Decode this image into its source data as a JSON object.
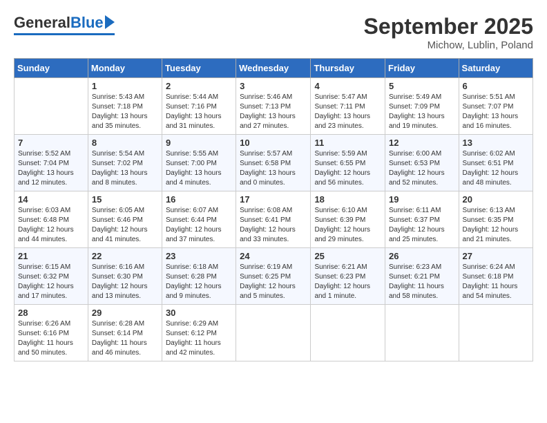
{
  "header": {
    "logo_general": "General",
    "logo_blue": "Blue",
    "month_title": "September 2025",
    "location": "Michow, Lublin, Poland"
  },
  "weekdays": [
    "Sunday",
    "Monday",
    "Tuesday",
    "Wednesday",
    "Thursday",
    "Friday",
    "Saturday"
  ],
  "weeks": [
    [
      {
        "day": "",
        "sunrise": "",
        "sunset": "",
        "daylight": ""
      },
      {
        "day": "1",
        "sunrise": "Sunrise: 5:43 AM",
        "sunset": "Sunset: 7:18 PM",
        "daylight": "Daylight: 13 hours and 35 minutes."
      },
      {
        "day": "2",
        "sunrise": "Sunrise: 5:44 AM",
        "sunset": "Sunset: 7:16 PM",
        "daylight": "Daylight: 13 hours and 31 minutes."
      },
      {
        "day": "3",
        "sunrise": "Sunrise: 5:46 AM",
        "sunset": "Sunset: 7:13 PM",
        "daylight": "Daylight: 13 hours and 27 minutes."
      },
      {
        "day": "4",
        "sunrise": "Sunrise: 5:47 AM",
        "sunset": "Sunset: 7:11 PM",
        "daylight": "Daylight: 13 hours and 23 minutes."
      },
      {
        "day": "5",
        "sunrise": "Sunrise: 5:49 AM",
        "sunset": "Sunset: 7:09 PM",
        "daylight": "Daylight: 13 hours and 19 minutes."
      },
      {
        "day": "6",
        "sunrise": "Sunrise: 5:51 AM",
        "sunset": "Sunset: 7:07 PM",
        "daylight": "Daylight: 13 hours and 16 minutes."
      }
    ],
    [
      {
        "day": "7",
        "sunrise": "Sunrise: 5:52 AM",
        "sunset": "Sunset: 7:04 PM",
        "daylight": "Daylight: 13 hours and 12 minutes."
      },
      {
        "day": "8",
        "sunrise": "Sunrise: 5:54 AM",
        "sunset": "Sunset: 7:02 PM",
        "daylight": "Daylight: 13 hours and 8 minutes."
      },
      {
        "day": "9",
        "sunrise": "Sunrise: 5:55 AM",
        "sunset": "Sunset: 7:00 PM",
        "daylight": "Daylight: 13 hours and 4 minutes."
      },
      {
        "day": "10",
        "sunrise": "Sunrise: 5:57 AM",
        "sunset": "Sunset: 6:58 PM",
        "daylight": "Daylight: 13 hours and 0 minutes."
      },
      {
        "day": "11",
        "sunrise": "Sunrise: 5:59 AM",
        "sunset": "Sunset: 6:55 PM",
        "daylight": "Daylight: 12 hours and 56 minutes."
      },
      {
        "day": "12",
        "sunrise": "Sunrise: 6:00 AM",
        "sunset": "Sunset: 6:53 PM",
        "daylight": "Daylight: 12 hours and 52 minutes."
      },
      {
        "day": "13",
        "sunrise": "Sunrise: 6:02 AM",
        "sunset": "Sunset: 6:51 PM",
        "daylight": "Daylight: 12 hours and 48 minutes."
      }
    ],
    [
      {
        "day": "14",
        "sunrise": "Sunrise: 6:03 AM",
        "sunset": "Sunset: 6:48 PM",
        "daylight": "Daylight: 12 hours and 44 minutes."
      },
      {
        "day": "15",
        "sunrise": "Sunrise: 6:05 AM",
        "sunset": "Sunset: 6:46 PM",
        "daylight": "Daylight: 12 hours and 41 minutes."
      },
      {
        "day": "16",
        "sunrise": "Sunrise: 6:07 AM",
        "sunset": "Sunset: 6:44 PM",
        "daylight": "Daylight: 12 hours and 37 minutes."
      },
      {
        "day": "17",
        "sunrise": "Sunrise: 6:08 AM",
        "sunset": "Sunset: 6:41 PM",
        "daylight": "Daylight: 12 hours and 33 minutes."
      },
      {
        "day": "18",
        "sunrise": "Sunrise: 6:10 AM",
        "sunset": "Sunset: 6:39 PM",
        "daylight": "Daylight: 12 hours and 29 minutes."
      },
      {
        "day": "19",
        "sunrise": "Sunrise: 6:11 AM",
        "sunset": "Sunset: 6:37 PM",
        "daylight": "Daylight: 12 hours and 25 minutes."
      },
      {
        "day": "20",
        "sunrise": "Sunrise: 6:13 AM",
        "sunset": "Sunset: 6:35 PM",
        "daylight": "Daylight: 12 hours and 21 minutes."
      }
    ],
    [
      {
        "day": "21",
        "sunrise": "Sunrise: 6:15 AM",
        "sunset": "Sunset: 6:32 PM",
        "daylight": "Daylight: 12 hours and 17 minutes."
      },
      {
        "day": "22",
        "sunrise": "Sunrise: 6:16 AM",
        "sunset": "Sunset: 6:30 PM",
        "daylight": "Daylight: 12 hours and 13 minutes."
      },
      {
        "day": "23",
        "sunrise": "Sunrise: 6:18 AM",
        "sunset": "Sunset: 6:28 PM",
        "daylight": "Daylight: 12 hours and 9 minutes."
      },
      {
        "day": "24",
        "sunrise": "Sunrise: 6:19 AM",
        "sunset": "Sunset: 6:25 PM",
        "daylight": "Daylight: 12 hours and 5 minutes."
      },
      {
        "day": "25",
        "sunrise": "Sunrise: 6:21 AM",
        "sunset": "Sunset: 6:23 PM",
        "daylight": "Daylight: 12 hours and 1 minute."
      },
      {
        "day": "26",
        "sunrise": "Sunrise: 6:23 AM",
        "sunset": "Sunset: 6:21 PM",
        "daylight": "Daylight: 11 hours and 58 minutes."
      },
      {
        "day": "27",
        "sunrise": "Sunrise: 6:24 AM",
        "sunset": "Sunset: 6:18 PM",
        "daylight": "Daylight: 11 hours and 54 minutes."
      }
    ],
    [
      {
        "day": "28",
        "sunrise": "Sunrise: 6:26 AM",
        "sunset": "Sunset: 6:16 PM",
        "daylight": "Daylight: 11 hours and 50 minutes."
      },
      {
        "day": "29",
        "sunrise": "Sunrise: 6:28 AM",
        "sunset": "Sunset: 6:14 PM",
        "daylight": "Daylight: 11 hours and 46 minutes."
      },
      {
        "day": "30",
        "sunrise": "Sunrise: 6:29 AM",
        "sunset": "Sunset: 6:12 PM",
        "daylight": "Daylight: 11 hours and 42 minutes."
      },
      {
        "day": "",
        "sunrise": "",
        "sunset": "",
        "daylight": ""
      },
      {
        "day": "",
        "sunrise": "",
        "sunset": "",
        "daylight": ""
      },
      {
        "day": "",
        "sunrise": "",
        "sunset": "",
        "daylight": ""
      },
      {
        "day": "",
        "sunrise": "",
        "sunset": "",
        "daylight": ""
      }
    ]
  ]
}
